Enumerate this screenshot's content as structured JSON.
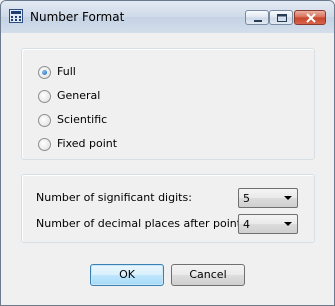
{
  "window": {
    "title": "Number Format",
    "icon": "calculator-icon"
  },
  "titlebar_buttons": {
    "minimize_icon": "minimize-icon",
    "maximize_icon": "maximize-icon",
    "close_icon": "close-icon"
  },
  "format_group": {
    "options": [
      {
        "label": "Full",
        "selected": true
      },
      {
        "label": "General",
        "selected": false
      },
      {
        "label": "Scientific",
        "selected": false
      },
      {
        "label": "Fixed point",
        "selected": false
      }
    ]
  },
  "digits_group": {
    "significant_digits_label": "Number of significant digits:",
    "significant_digits_value": "5",
    "decimal_places_label": "Number of decimal places after point:",
    "decimal_places_value": "4"
  },
  "buttons": {
    "ok_label": "OK",
    "cancel_label": "Cancel"
  },
  "colors": {
    "default_button_border": "#3c7fb1",
    "radio_selected": "#1d5fa8"
  }
}
